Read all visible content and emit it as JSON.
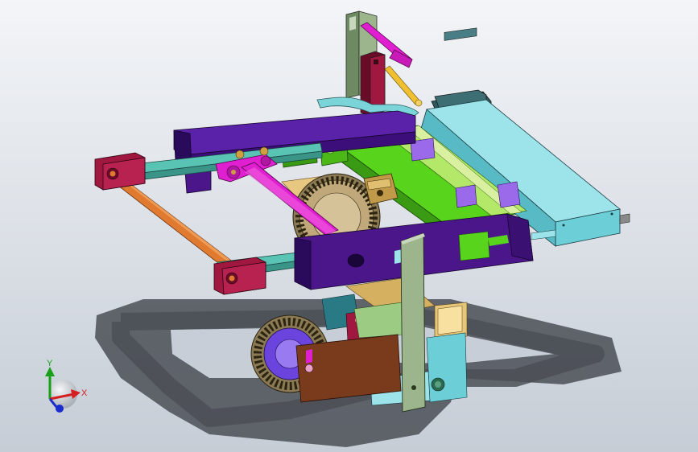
{
  "triad": {
    "x_label": "X",
    "y_label": "Y",
    "x_color": "#d42020",
    "y_color": "#18a018",
    "z_color": "#1a2ccc"
  },
  "colors": {
    "bg_top": "#f3f5f8",
    "bg_bottom": "#c6cdd6",
    "shadow": "#4b4f56",
    "purple_frame": "#4a168a",
    "green_rail": "#58d41c",
    "cyan_actuator": "#6ccfd8",
    "magenta_rod": "#e020d0",
    "orange_rod": "#e07a30",
    "teal_link": "#5ac4b4",
    "maroon_block": "#a01840",
    "sage_plate": "#9ccc84",
    "brown_plate": "#7a3a1c",
    "gear_tan": "#c0a87a",
    "gear_purple": "#6a44dc",
    "olive_frame": "#7c986c"
  }
}
